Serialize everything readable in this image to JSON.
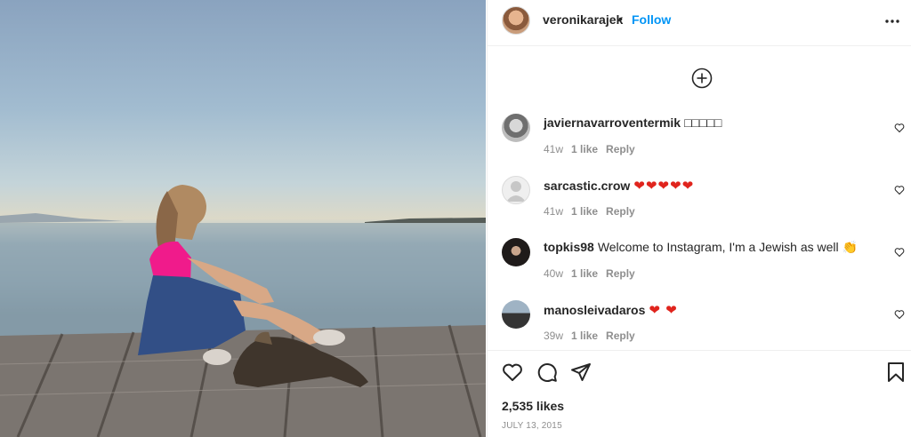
{
  "post": {
    "author": "veronikarajek",
    "separator": "•",
    "follow_label": "Follow",
    "likes_text": "2,535 likes",
    "date": "JULY 13, 2015"
  },
  "comments": [
    {
      "username": "javiernavarroventermik",
      "text": "□□□□□",
      "age": "41w",
      "likes": "1 like",
      "reply": "Reply"
    },
    {
      "username": "sarcastic.crow",
      "text": "❤❤❤❤❤",
      "age": "41w",
      "likes": "1 like",
      "reply": "Reply"
    },
    {
      "username": "topkis98",
      "text": "Welcome to Instagram, I'm a Jewish as well 👏",
      "age": "40w",
      "likes": "1 like",
      "reply": "Reply"
    },
    {
      "username": "manosleivadaros",
      "text": "❤ ❤",
      "age": "39w",
      "likes": "1 like",
      "reply": "Reply"
    }
  ],
  "icons": {
    "more": "more-options-icon",
    "add": "add-circle-icon",
    "like": "heart-icon",
    "comment": "comment-icon",
    "share": "send-icon",
    "save": "bookmark-icon"
  },
  "colors": {
    "accent": "#0095f6",
    "muted": "#8e8e8e",
    "heart": "#e0241d"
  }
}
